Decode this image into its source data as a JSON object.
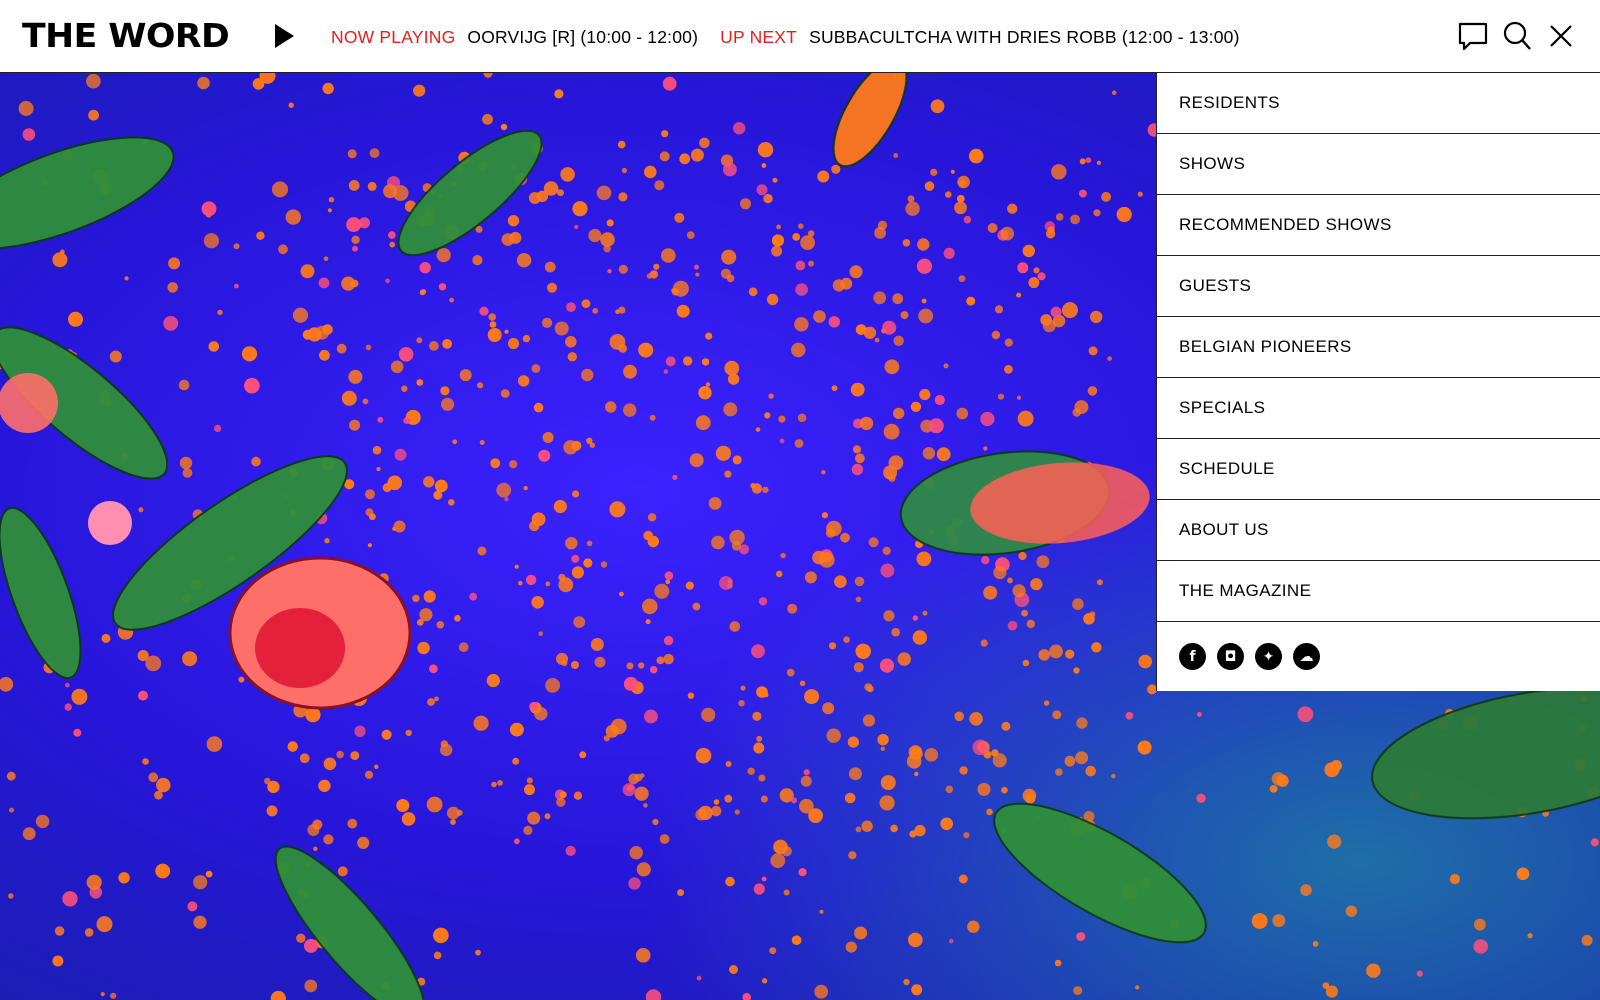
{
  "header": {
    "logo": "THE WORD",
    "now_playing_label": "NOW PLAYING",
    "now_playing_value": "OORVIJG [R] (10:00 - 12:00)",
    "up_next_label": "UP NEXT",
    "up_next_value": "SUBBACULTCHA WITH DRIES ROBB (12:00 - 13:00)",
    "icons": [
      "chat-icon",
      "search-icon",
      "close-icon"
    ]
  },
  "menu": {
    "items": [
      {
        "label": "RESIDENTS"
      },
      {
        "label": "SHOWS"
      },
      {
        "label": "RECOMMENDED SHOWS"
      },
      {
        "label": "GUESTS"
      },
      {
        "label": "BELGIAN PIONEERS"
      },
      {
        "label": "SPECIALS"
      },
      {
        "label": "SCHEDULE"
      },
      {
        "label": "ABOUT US"
      },
      {
        "label": "THE MAGAZINE"
      }
    ],
    "social": [
      {
        "name": "facebook-icon",
        "glyph": "f"
      },
      {
        "name": "instagram-icon",
        "glyph": "◘"
      },
      {
        "name": "twitter-icon",
        "glyph": "✦"
      },
      {
        "name": "mixcloud-icon",
        "glyph": "☁"
      }
    ]
  },
  "colors": {
    "accent": "#e4201c",
    "background_blue": "#2a1ee6",
    "background_orange": "#ff7a1a",
    "background_green": "#2e8a3a"
  }
}
